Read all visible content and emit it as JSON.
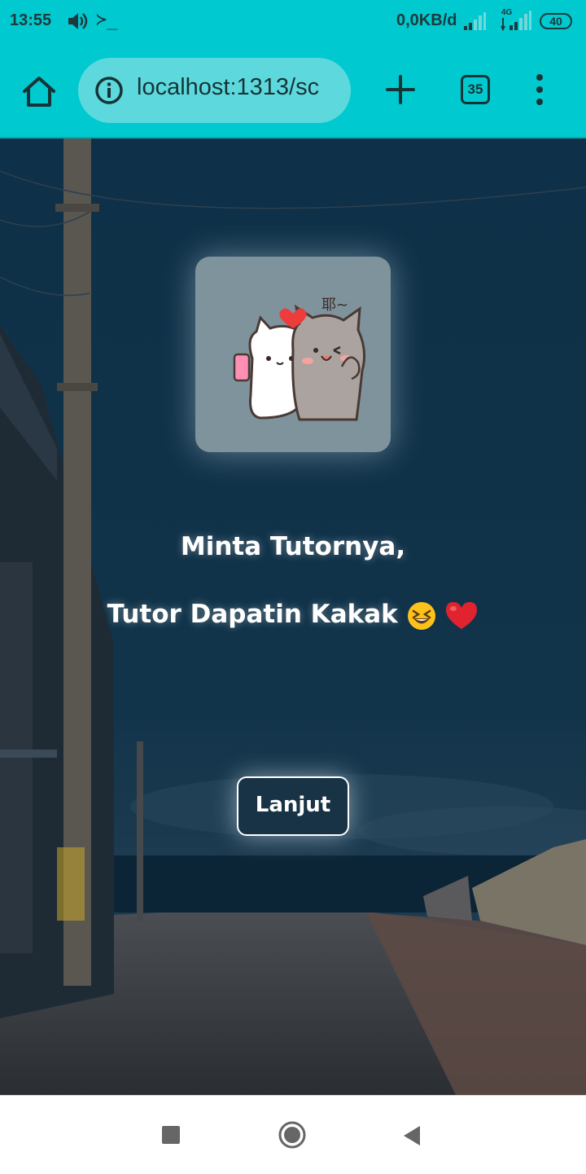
{
  "status_bar": {
    "time": "13:55",
    "terminal_glyph": "≻_",
    "network_speed": "0,0KB/d",
    "network_type": "4G",
    "battery": "40"
  },
  "browser": {
    "url": "localhost:1313/sc",
    "tab_count": "35",
    "theme_color": "#00c9cf"
  },
  "page": {
    "line1": "Minta Tutornya,",
    "line2": "Tutor Dapatin Kakak",
    "emojis": [
      "laughing-face",
      "red-heart"
    ],
    "next_button": "Lanjut",
    "sticker_text": "耶~"
  },
  "nav": {
    "buttons": [
      "recent-apps",
      "home",
      "back"
    ]
  }
}
